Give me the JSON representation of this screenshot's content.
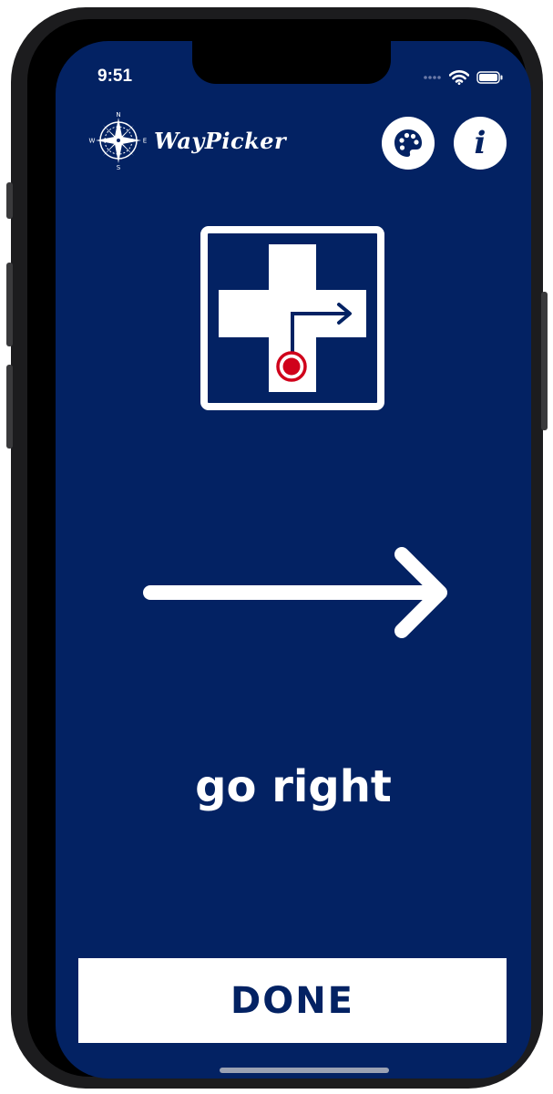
{
  "status_bar": {
    "time": "9:51",
    "signal_icon": "cellular-signal-icon",
    "wifi_icon": "wifi-icon",
    "battery_icon": "battery-icon"
  },
  "header": {
    "app_name": "WayPicker",
    "logo_icon": "compass-rose-icon",
    "compass_labels": {
      "n": "N",
      "e": "E",
      "s": "S",
      "w": "W"
    },
    "palette_icon": "palette-icon",
    "info_label": "i"
  },
  "direction": {
    "sign_icon": "turn-right-intersection-icon",
    "arrow_icon": "arrow-right-icon",
    "text": "go right"
  },
  "actions": {
    "done_label": "DONE"
  },
  "colors": {
    "background": "#032263",
    "foreground": "#ffffff",
    "marker": "#d0021b"
  }
}
